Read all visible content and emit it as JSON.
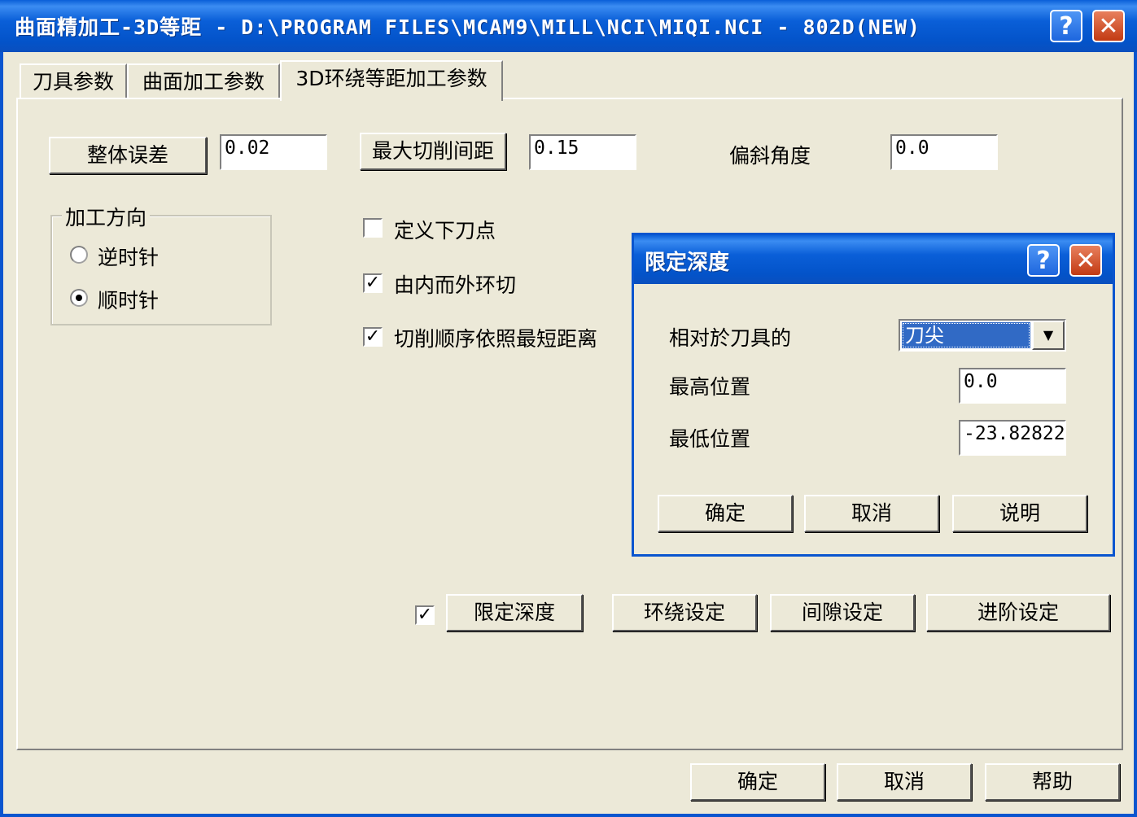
{
  "window": {
    "title": "曲面精加工-3D等距 - D:\\PROGRAM FILES\\MCAM9\\MILL\\NCI\\MIQI.NCI - 802D(NEW)",
    "help_icon": "question-mark-icon",
    "close_icon": "close-x-icon"
  },
  "tabs": [
    {
      "label": "刀具参数",
      "active": false
    },
    {
      "label": "曲面加工参数",
      "active": false
    },
    {
      "label": "3D环绕等距加工参数",
      "active": true
    }
  ],
  "params": {
    "overall_tolerance_label": "整体误差",
    "overall_tolerance_value": "0.02",
    "max_stepover_label": "最大切削间距",
    "max_stepover_value": "0.15",
    "tilt_angle_label": "偏斜角度",
    "tilt_angle_value": "0.0"
  },
  "direction": {
    "group_label": "加工方向",
    "options": [
      {
        "label": "逆时针",
        "selected": false
      },
      {
        "label": "顺时针",
        "selected": true
      }
    ]
  },
  "checkboxes": [
    {
      "label": "定义下刀点",
      "checked": false
    },
    {
      "label": "由内而外环切",
      "checked": true
    },
    {
      "label": "切削顺序依照最短距离",
      "checked": true
    }
  ],
  "bottom_buttons": {
    "limit_depth_checked": true,
    "limit_depth": "限定深度",
    "wrap_settings": "环绕设定",
    "gap_settings": "间隙设定",
    "advanced_settings": "进阶设定"
  },
  "footer": {
    "ok": "确定",
    "cancel": "取消",
    "help": "帮助"
  },
  "dialog": {
    "title": "限定深度",
    "relative_label": "相对於刀具的",
    "relative_value": "刀尖",
    "top_label": "最高位置",
    "top_value": "0.0",
    "bottom_label": "最低位置",
    "bottom_value": "-23.82822",
    "ok": "确定",
    "cancel": "取消",
    "explain": "说明"
  },
  "colors": {
    "titlebar": "#0a5fd8",
    "face": "#ece9d8",
    "selection": "#316ac5"
  }
}
